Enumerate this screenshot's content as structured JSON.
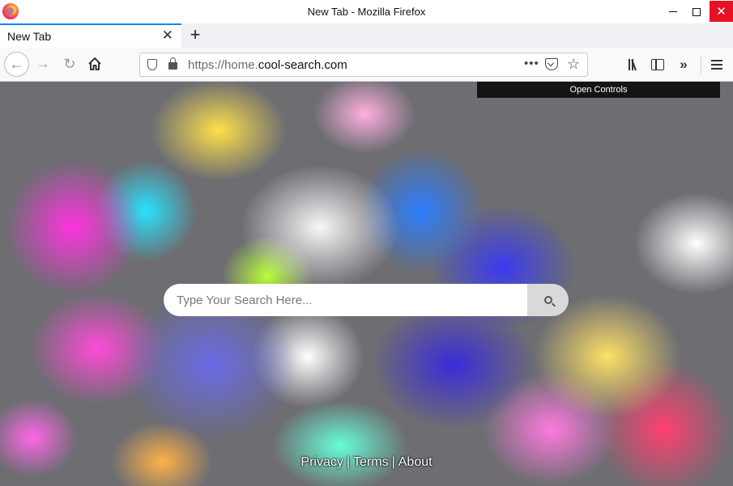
{
  "window": {
    "title": "New Tab - Mozilla Firefox"
  },
  "tabs": [
    {
      "label": "New Tab"
    }
  ],
  "new_tab_symbol": "+",
  "navbar": {
    "url_prefix": "https://home.",
    "url_host": "cool-search.com",
    "page_actions": "•••"
  },
  "page": {
    "open_controls": "Open Controls",
    "search_placeholder": "Type Your Search Here...",
    "footer": {
      "privacy": "Privacy",
      "terms": "Terms",
      "about": "About",
      "separator": "|"
    }
  },
  "icons": {
    "app": "firefox-logo-icon",
    "back": "arrow-left-icon",
    "forward": "arrow-right-icon",
    "reload": "reload-icon",
    "home": "home-icon",
    "tracking": "shield-icon",
    "lock": "lock-icon",
    "pocket": "pocket-icon",
    "bookmark": "star-icon",
    "library": "library-icon",
    "sidebar": "sidebar-icon",
    "overflow": "chevron-double-right-icon",
    "menu": "hamburger-menu-icon",
    "search": "search-icon"
  },
  "colors": {
    "active_tab_accent": "#0a84ff",
    "close_button": "#e81123",
    "open_controls_bg": "#141414"
  }
}
